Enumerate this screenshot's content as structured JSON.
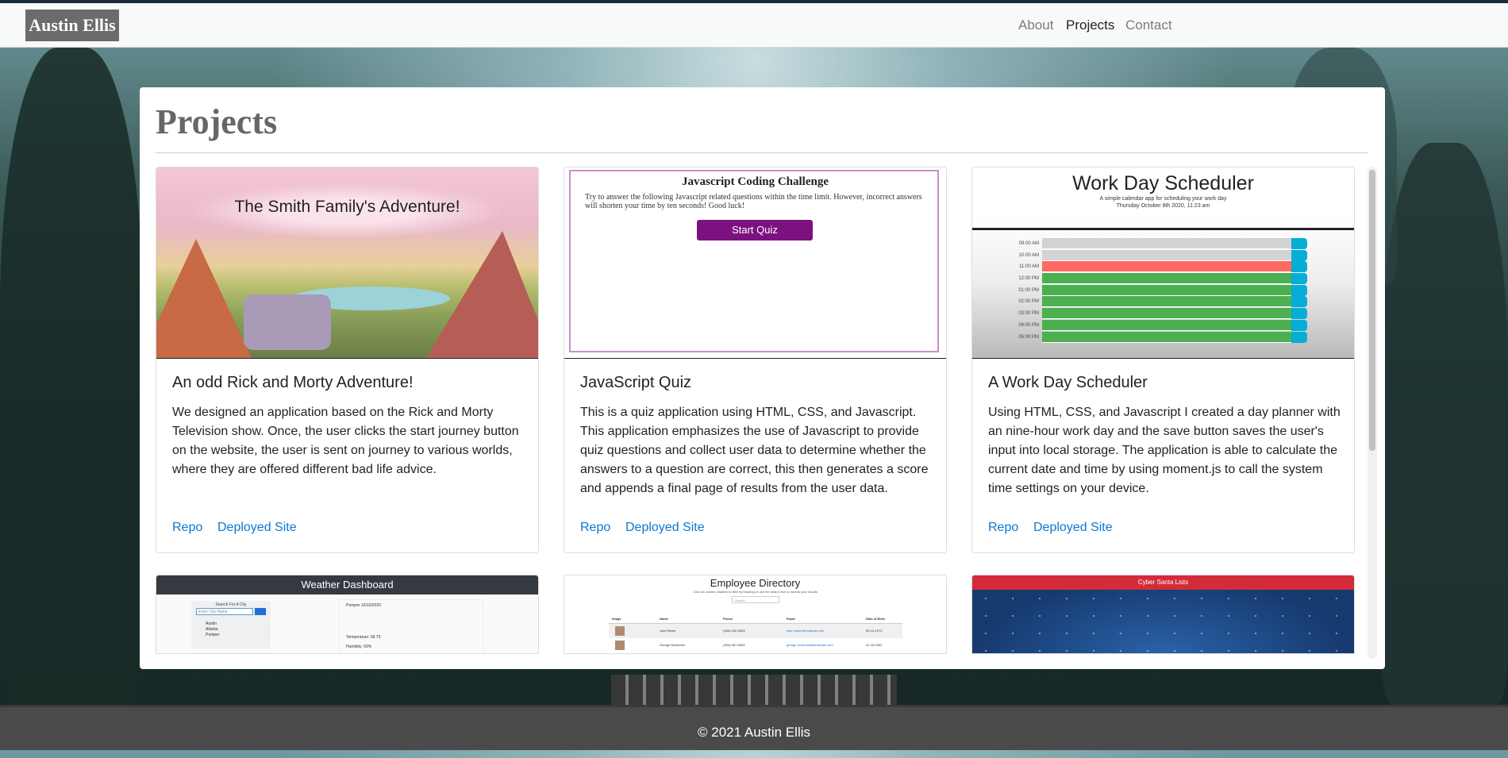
{
  "navbar": {
    "brand": "Austin Ellis",
    "links": [
      "About",
      "Projects",
      "Contact"
    ]
  },
  "page": {
    "title": "Projects"
  },
  "projects": [
    {
      "image_caption": "The Smith Family's Adventure!",
      "title": "An odd Rick and Morty Adventure!",
      "description": "We designed an application based on the Rick and Morty Television show. Once, the user clicks the start journey button on the website, the user is sent on journey to various worlds, where they are offered different bad life advice.",
      "repo_label": "Repo",
      "site_label": "Deployed Site"
    },
    {
      "image_caption": "Javascript Coding Challenge",
      "image_text": "Try to answer the following Javascript related questions within the time limit. However, incorrect answers will shorten your time by ten seconds! Good luck!",
      "image_button": "Start Quiz",
      "title": "JavaScript Quiz",
      "description": "This is a quiz application using HTML, CSS, and Javascript. This application emphasizes the use of Javascript to provide quiz questions and collect user data to determine whether the answers to a question are correct, this then generates a score and appends a final page of results from the user data.",
      "repo_label": "Repo",
      "site_label": "Deployed Site"
    },
    {
      "image_caption": "Work Day Scheduler",
      "image_subtitle": "A simple calendar app for scheduling your work day",
      "image_date": "Thursday October 8th 2020, 11:23 am",
      "image_times": [
        "09:00 AM",
        "10:00 AM",
        "11:00 AM",
        "12:00 PM",
        "01:00 PM",
        "02:00 PM",
        "03:00 PM",
        "04:00 PM",
        "05:00 PM"
      ],
      "title": "A Work Day Scheduler",
      "description": "Using HTML, CSS, and Javascript I created a day planner with an nine-hour work day and the save button saves the user's input into local storage. The application is able to calculate the current date and time by using moment.js to call the system time settings on your device.",
      "repo_label": "Repo",
      "site_label": "Deployed Site"
    }
  ],
  "partial_cards": [
    {
      "image_caption": "Weather Dashboard",
      "search_label": "Search For A City",
      "placeholder": "Enter City Name",
      "cities": [
        "Austin",
        "Atlanta",
        "Pomper"
      ],
      "readouts": [
        "Pomper 10/10/2020",
        "Temperature: 58.79",
        "Humidity: 69%"
      ]
    },
    {
      "image_caption": "Employee Directory",
      "subtitle": "Click on column headers to filter by heading or use the search box to narrow your results",
      "search_placeholder": "Search",
      "headers": [
        "Image",
        "Name",
        "Phone",
        "Email",
        "Date of Birth"
      ],
      "rows": [
        [
          "Jose Meyer",
          "(480)-232-5363",
          "jose.meyer@example.com",
          "05-13-1970"
        ],
        [
          "George Mcdonald",
          "(350)-967-6369",
          "george.mcdonald@example.com",
          "11-18-1962"
        ]
      ]
    },
    {
      "image_caption": "Cyber Santa Lists"
    }
  ],
  "footer": {
    "text": "© 2021 Austin Ellis"
  },
  "colors": {
    "link": "#0b77d4",
    "footer_bg": "#4a4a4a",
    "brand_bg": "#6b6b6b",
    "scheduler_past": "#d3d3d3",
    "scheduler_present": "#ff6961",
    "scheduler_future": "#4caf50",
    "scheduler_save": "#06aed5"
  }
}
